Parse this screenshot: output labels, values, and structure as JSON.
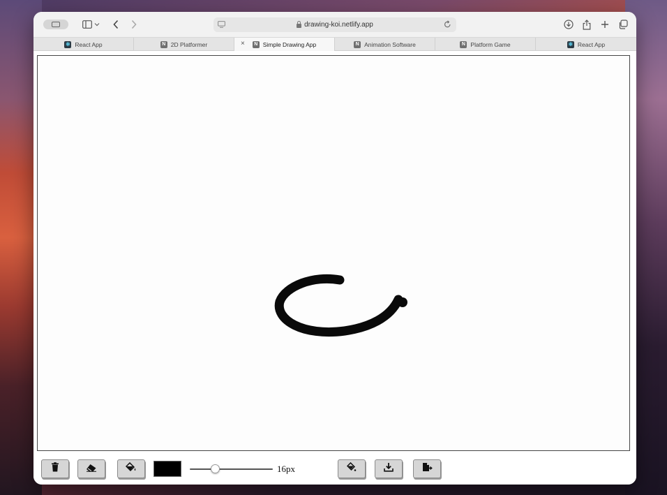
{
  "browser": {
    "url": "drawing-koi.netlify.app",
    "tabs": [
      {
        "label": "React App",
        "favicon": "react-icon",
        "active": false
      },
      {
        "label": "2D Platformer",
        "favicon": "netlify-icon",
        "active": false
      },
      {
        "label": "Simple Drawing App",
        "favicon": "netlify-icon",
        "active": true
      },
      {
        "label": "Animation Software",
        "favicon": "netlify-icon",
        "active": false
      },
      {
        "label": "Platform Game",
        "favicon": "netlify-icon",
        "active": false
      },
      {
        "label": "React App",
        "favicon": "react-icon",
        "active": false
      }
    ],
    "netlify_favicon_letter": "N",
    "close_glyph": "×"
  },
  "app": {
    "brush_color": "#000000",
    "brush_size_value": 16,
    "brush_size_label": "16px",
    "brush_size_range": [
      1,
      50
    ],
    "stroke_color": "#0a0a0a",
    "buttons": {
      "left": [
        "trash-icon",
        "eraser-icon",
        "paint-bucket-icon"
      ],
      "right": [
        "fill-icon",
        "download-icon",
        "export-icon"
      ]
    }
  },
  "colors": {
    "accent_stroke": "#0a0a0a",
    "button_bg": "#d6d6d6"
  }
}
